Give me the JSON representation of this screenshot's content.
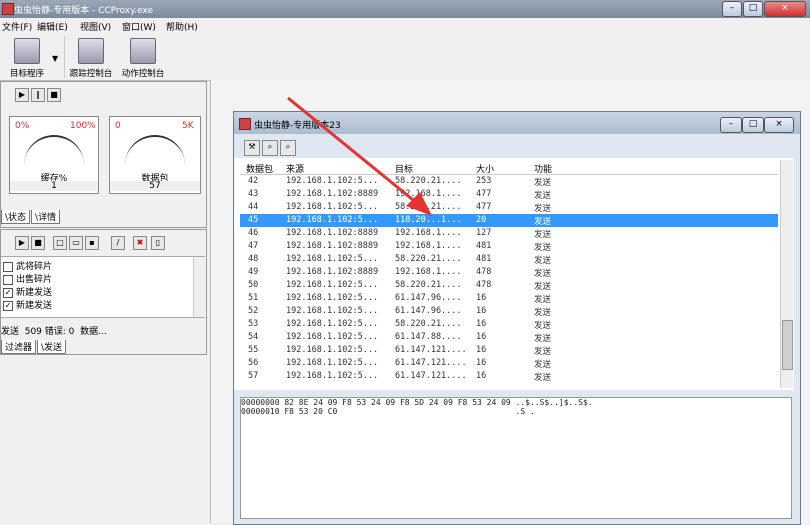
{
  "window": {
    "title": "虫虫怡静-专用版本 - CCProxy.exe",
    "min": "–",
    "max": "□",
    "close": "×"
  },
  "menu": [
    "文件(F)",
    "编辑(E)",
    "视图(V)",
    "窗口(W)",
    "帮助(H)"
  ],
  "toolbar": [
    {
      "label": "目标程序",
      "icon": "target-program-icon"
    },
    {
      "label": "跟踪控制台",
      "icon": "trace-console-icon"
    },
    {
      "label": "动作控制台",
      "icon": "action-console-icon"
    }
  ],
  "gauges": [
    {
      "min": "0%",
      "max": "100%",
      "label": "缓存%",
      "value": "1",
      "level": 0.02
    },
    {
      "min": "0",
      "max": "5K",
      "label": "数据包",
      "value": "57",
      "level": 0.01
    }
  ],
  "left_tabs": [
    "\\状态",
    "\\详情"
  ],
  "filters": [
    {
      "label": "武将碎片",
      "checked": false
    },
    {
      "label": "出售碎片",
      "checked": false
    },
    {
      "label": "新建发送",
      "checked": true
    },
    {
      "label": "新建发送",
      "checked": true
    }
  ],
  "status": "发送  509 错误: 0  数据...",
  "bottom_tabs": [
    "过滤器",
    "\\发送"
  ],
  "inner": {
    "title": "虫虫怡静-专用版本23",
    "columns": [
      "数据包",
      "来源",
      "目标",
      "大小",
      "功能"
    ],
    "rows": [
      [
        "42",
        "192.168.1.102:5...",
        "58.220.21....",
        "253",
        "发送"
      ],
      [
        "43",
        "192.168.1.102:8889",
        "192.168.1....",
        "477",
        "发送"
      ],
      [
        "44",
        "192.168.1.102:5...",
        "58.220.21....",
        "477",
        "发送"
      ],
      [
        "45",
        "192.168.1.102:5...",
        "118.20...1...",
        "20",
        "发送"
      ],
      [
        "46",
        "192.168.1.102:8889",
        "192.168.1....",
        "127",
        "发送"
      ],
      [
        "47",
        "192.168.1.102:8889",
        "192.168.1....",
        "481",
        "发送"
      ],
      [
        "48",
        "192.168.1.102:5...",
        "58.220.21....",
        "481",
        "发送"
      ],
      [
        "49",
        "192.168.1.102:8889",
        "192.168.1....",
        "478",
        "发送"
      ],
      [
        "50",
        "192.168.1.102:5...",
        "58.220.21....",
        "478",
        "发送"
      ],
      [
        "51",
        "192.168.1.102:5...",
        "61.147.96....",
        "16",
        "发送"
      ],
      [
        "52",
        "192.168.1.102:5...",
        "61.147.96....",
        "16",
        "发送"
      ],
      [
        "53",
        "192.168.1.102:5...",
        "58.220.21....",
        "16",
        "发送"
      ],
      [
        "54",
        "192.168.1.102:5...",
        "61.147.88....",
        "16",
        "发送"
      ],
      [
        "55",
        "192.168.1.102:5...",
        "61.147.121....",
        "16",
        "发送"
      ],
      [
        "56",
        "192.168.1.102:5...",
        "61.147.121....",
        "16",
        "发送"
      ],
      [
        "57",
        "192.168.1.102:5...",
        "61.147.121....",
        "16",
        "发送"
      ]
    ],
    "selected_index": 3,
    "hex": [
      "00000000 82 8E 24 09 F8 53 24 09 F8 5D 24 09 F8 53 24 09 ..$..S$..]$..S$.",
      "00000010 F8 53 20 C0                                     .S ."
    ]
  },
  "colors": {
    "arrow": "#e53333",
    "selection": "#3399ff"
  }
}
